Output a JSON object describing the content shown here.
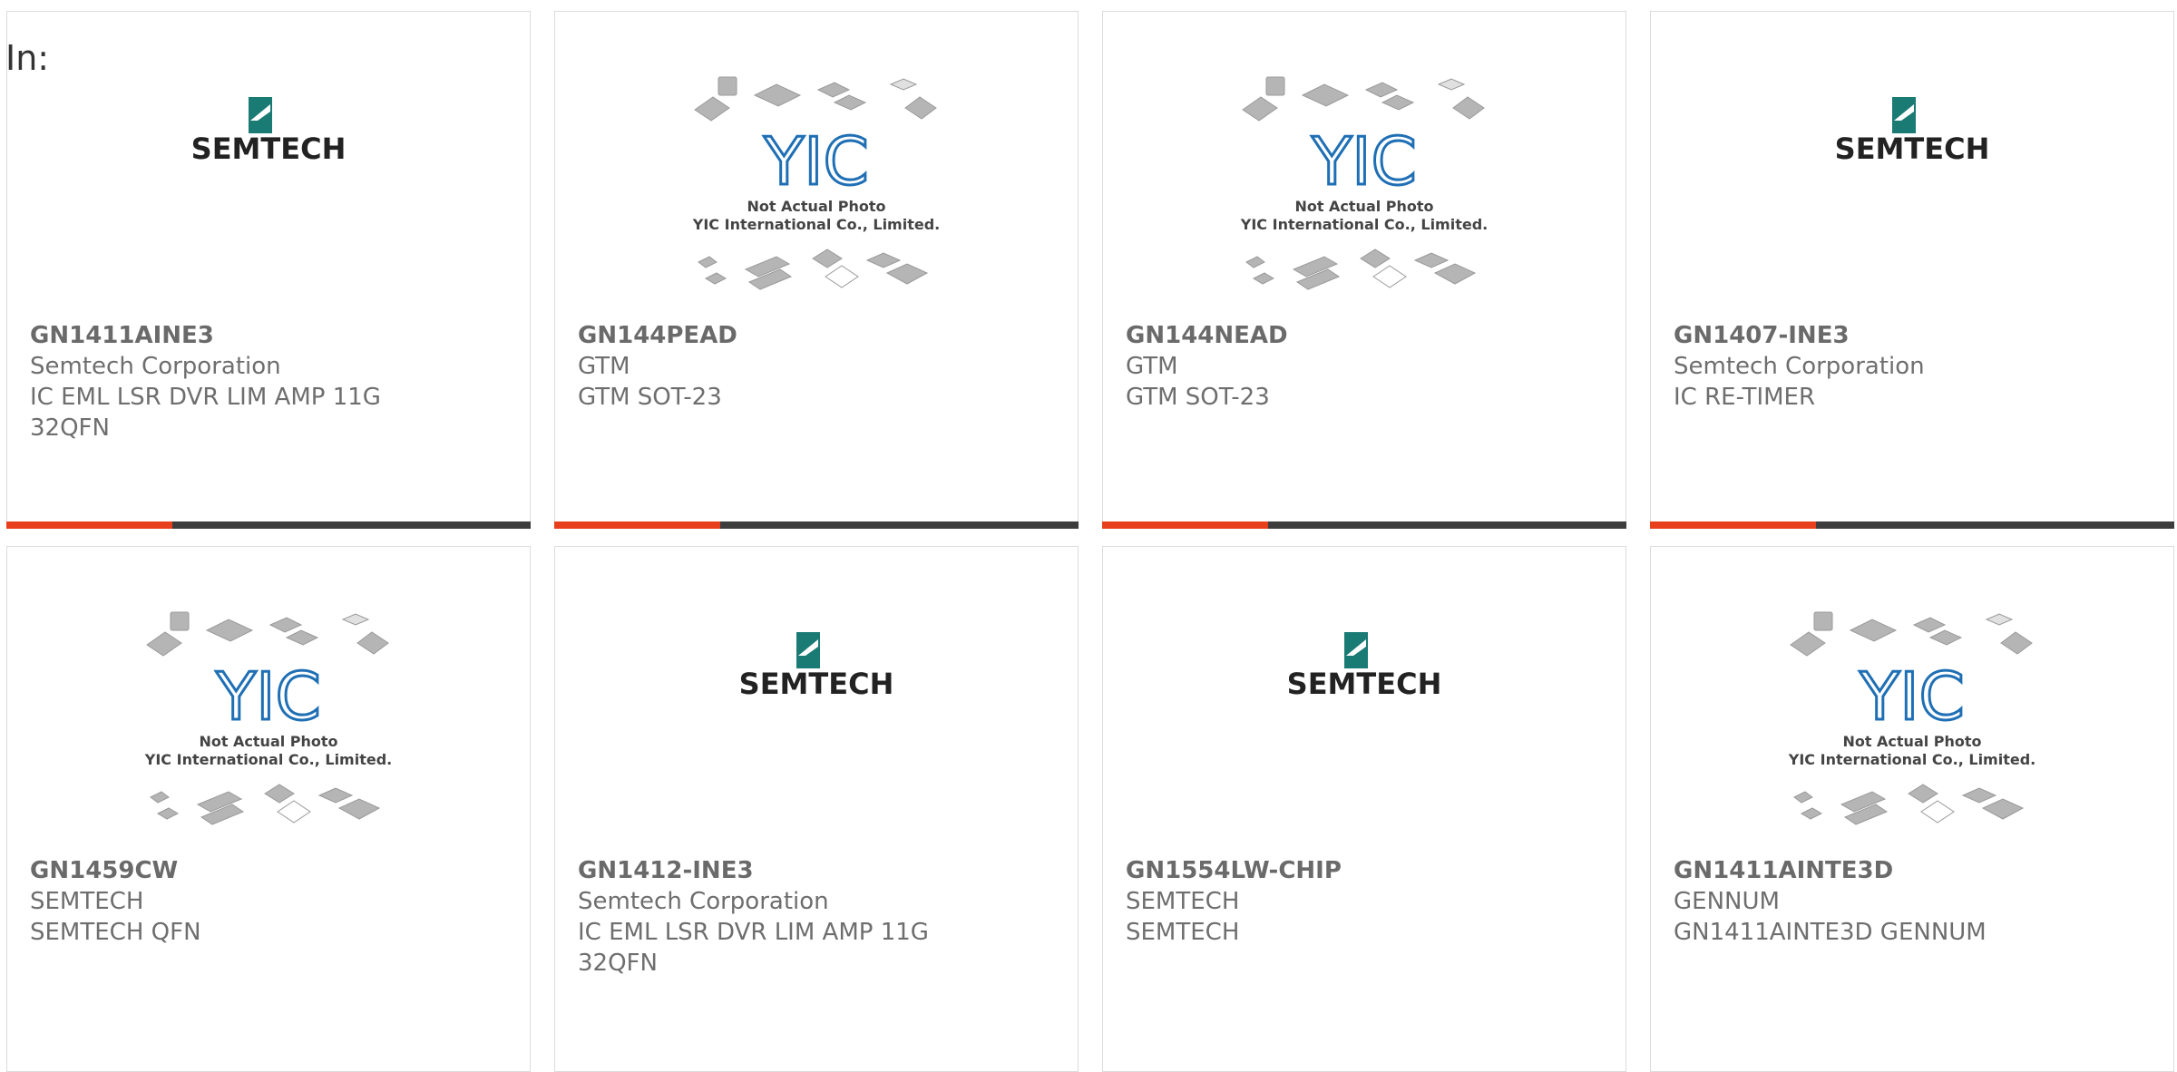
{
  "header": {
    "in_label": "In:"
  },
  "logos": {
    "semtech": {
      "text": "SEMTECH"
    },
    "yic": {
      "mark": "YIC",
      "line1": "Not Actual Photo",
      "line2": "YIC International Co., Limited."
    }
  },
  "colors": {
    "accent": "#e8401c",
    "bar": "#3d3d3d",
    "semtech_teal": "#1a7a74",
    "yic_blue": "#1f6fb5"
  },
  "products": [
    {
      "part": "GN1411AINE3",
      "manufacturer": "Semtech Corporation",
      "description": "IC EML LSR DVR LIM AMP 11G 32QFN",
      "image": "semtech-logo"
    },
    {
      "part": "GN144PEAD",
      "manufacturer": "GTM",
      "description": "GTM SOT-23",
      "image": "yic-placeholder"
    },
    {
      "part": "GN144NEAD",
      "manufacturer": "GTM",
      "description": "GTM SOT-23",
      "image": "yic-placeholder"
    },
    {
      "part": "GN1407-INE3",
      "manufacturer": "Semtech Corporation",
      "description": "IC RE-TIMER",
      "image": "semtech-logo"
    },
    {
      "part": "GN1459CW",
      "manufacturer": "SEMTECH",
      "description": "SEMTECH QFN",
      "image": "yic-placeholder"
    },
    {
      "part": "GN1412-INE3",
      "manufacturer": "Semtech Corporation",
      "description": "IC EML LSR DVR LIM AMP 11G 32QFN",
      "image": "semtech-logo"
    },
    {
      "part": "GN1554LW-CHIP",
      "manufacturer": "SEMTECH",
      "description": "SEMTECH",
      "image": "semtech-logo"
    },
    {
      "part": "GN1411AINTE3D",
      "manufacturer": "GENNUM",
      "description": "GN1411AINTE3D GENNUM",
      "image": "yic-placeholder"
    }
  ]
}
